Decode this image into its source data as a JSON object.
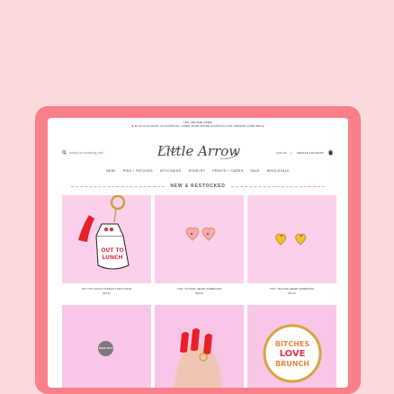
{
  "announcement": {
    "line1": "YES, WE ARE OPEN!",
    "line2": "$3.50 FLAT RATE US SHIPPING • FREE WORLDWIDE SHIPPING FOR ORDERS OVER $50"
  },
  "header": {
    "search_placeholder": "looking for something cute?",
    "logo_text": "Little Arrow",
    "login_label": "LOG IN",
    "separator": "or",
    "create_account_label": "CREATE ACCOUNT"
  },
  "nav": {
    "items": [
      "NEW!",
      "PINS + PATCHES",
      "KEYCHAINS",
      "JEWELRY",
      "PRINTS + CARDS",
      "SALE",
      "WHOLESALE"
    ]
  },
  "section": {
    "title": "NEW & RESTOCKED"
  },
  "products": [
    {
      "name": "OUT TO LUNCH TAKEOUT KEYCHAIN",
      "price": "$16.00",
      "image_text": [
        "OUT TO",
        "LUNCH"
      ]
    },
    {
      "name": "TINY YO PINK HEART EARRINGS",
      "price": "$16.00"
    },
    {
      "name": "TINY YELLOW HEART EARRINGS",
      "price": "$16.00"
    },
    {
      "name": "",
      "price": "",
      "badge": "SOLD OUT"
    },
    {
      "name": "",
      "price": ""
    },
    {
      "name": "",
      "price": "",
      "image_text": [
        "BITCHES",
        "LOVE",
        "BRUNCH"
      ]
    }
  ],
  "colors": {
    "background": "#fcdadb",
    "tablet_frame": "#f97f8b",
    "product_bg": "#fcd0ec",
    "accent": "#f5a3ad"
  }
}
